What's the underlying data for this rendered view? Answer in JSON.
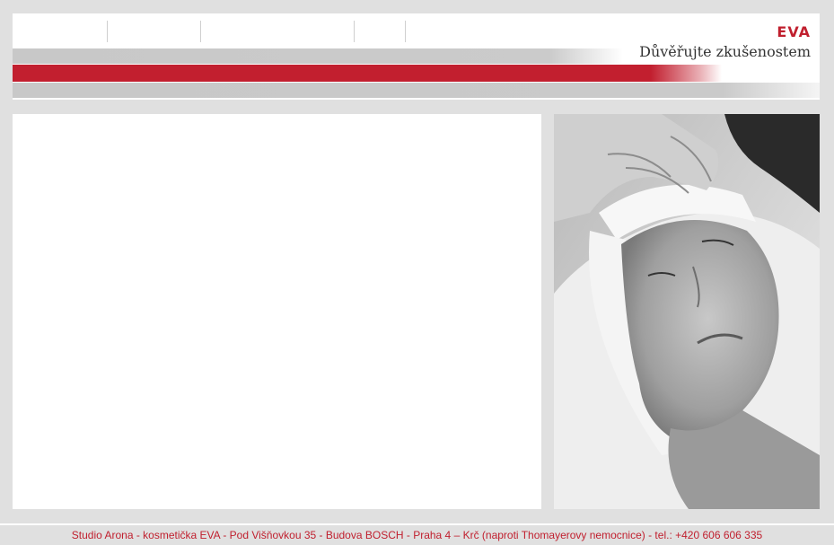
{
  "brand": {
    "name": "EVA",
    "tagline": "Důvěřujte zkušenostem",
    "accent": "#c01f2e"
  },
  "photo": {
    "subject": "facial-massage-photo"
  },
  "footer": {
    "text": "Studio Arona   -   kosmetička EVA   -   Pod Višňovkou 35   -   Budova BOSCH   -   Praha 4 – Krč (naproti Thomayerovy nemocnice)   -   tel.: +420 606 606 335"
  }
}
